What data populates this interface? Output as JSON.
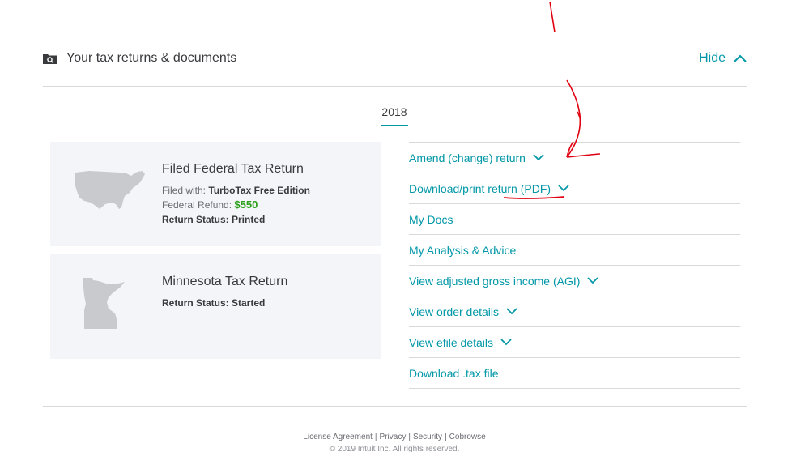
{
  "section": {
    "title": "Your tax returns & documents",
    "hide_label": "Hide"
  },
  "year_tab": {
    "label": "2018"
  },
  "returns": {
    "federal": {
      "title": "Filed Federal Tax Return",
      "filed_with_label": "Filed with: ",
      "filed_with_value": "TurboTax Free Edition",
      "refund_label": "Federal Refund: ",
      "refund_value": "$550",
      "status": "Return Status: Printed"
    },
    "minnesota": {
      "title": "Minnesota Tax Return",
      "status": "Return Status: Started"
    }
  },
  "links": [
    {
      "label": "Amend (change) return"
    },
    {
      "label": "Download/print return (PDF)"
    },
    {
      "label": "My Docs"
    },
    {
      "label": "My Analysis & Advice"
    },
    {
      "label": "View adjusted gross income (AGI)"
    },
    {
      "label": "View order details"
    },
    {
      "label": "View efile details"
    },
    {
      "label": "Download .tax file"
    }
  ],
  "footer": {
    "license": "License Agreement",
    "privacy": "Privacy",
    "security": "Security",
    "cobrowse": "Cobrowse",
    "separator": "|",
    "copyright": "© 2019 Intuit Inc. All rights reserved."
  },
  "colors": {
    "accent": "#0097a7",
    "refund": "#2ca01c",
    "card_bg": "#f4f5f8",
    "annotation": "#e0000f"
  },
  "icons": {
    "section": "folder-search-icon",
    "hide": "chevron-up-icon",
    "expand": "chevron-down-icon",
    "federal_map": "usa-map-icon",
    "state_map": "minnesota-map-icon"
  }
}
